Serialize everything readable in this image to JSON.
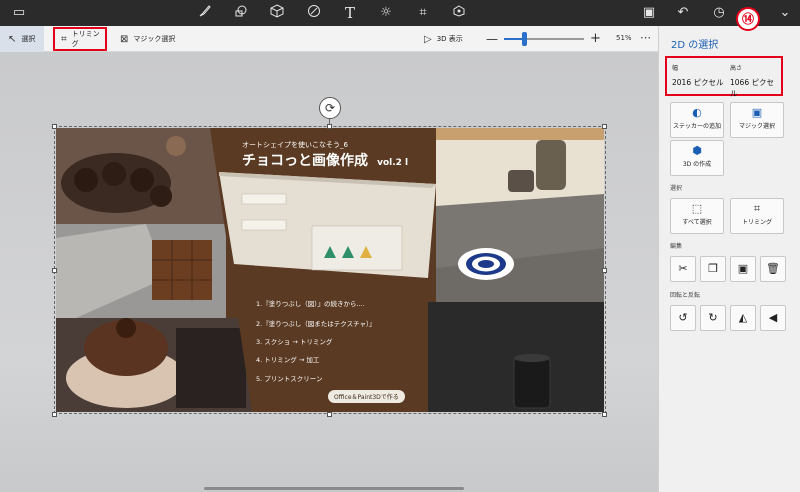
{
  "toolbar": {
    "icons": [
      "folder-icon",
      "brush-icon",
      "shapes-2d-icon",
      "shapes-3d-icon",
      "stickers-icon",
      "text-icon",
      "effects-icon",
      "canvas-icon",
      "library-3d-icon",
      "paste-icon",
      "undo-icon",
      "history-icon",
      "chevron-down-icon"
    ]
  },
  "subbar": {
    "select_label": "選択",
    "trim_label": "トリミング",
    "magic_label": "マジック選択",
    "view3d_label": "3D 表示",
    "zoom_percent": "51%",
    "zoom_level": 0.25
  },
  "panel": {
    "title": "2D の選択",
    "badge": "⑭",
    "width_label": "幅",
    "height_label": "高さ",
    "width_value": "2016 ピクセル",
    "height_value": "1066 ピクセル",
    "sticker_label": "ステッカーの追加",
    "magic_label": "マジック選択",
    "make3d_label": "3D の作成",
    "section_select": "選択",
    "select_all_label": "すべて選択",
    "trim_label": "トリミング",
    "section_edit": "編集",
    "section_rotate": "回転と反転"
  },
  "image": {
    "subtitle": "オートシェイプを使いこなそう_6",
    "title": "チョコっと画像作成",
    "version": "vol.2 l",
    "steps": [
      "1.『塗りつぶし（図）』の続きから....",
      "2.『塗りつぶし（図またはテクスチャ）』",
      "3. スクショ → トリミング",
      "4. トリミング → 加工",
      "5. プリントスクリーン"
    ],
    "credit": "Office＆Paint3Dで作る"
  },
  "colors": {
    "accent_blue": "#1a5fb4",
    "highlight_red": "#e3001b",
    "chocolate_brown": "#5a3a22"
  }
}
